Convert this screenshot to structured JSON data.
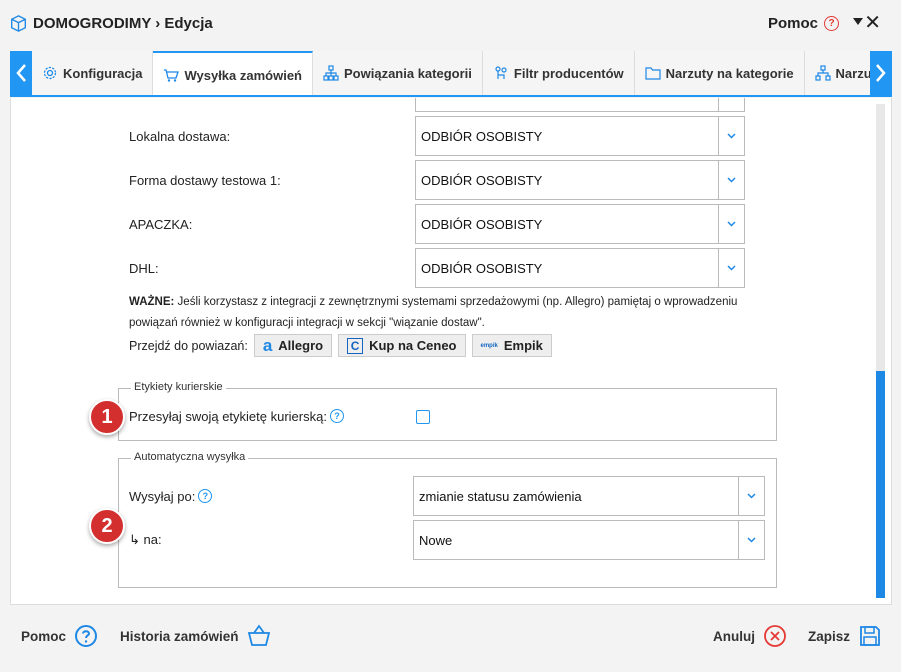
{
  "window": {
    "title": "DOMOGRODIMY › Edycja",
    "help_label": "Pomoc",
    "help_q": "?"
  },
  "tabs": [
    {
      "label": "Konfiguracja",
      "icon": "gear-icon"
    },
    {
      "label": "Wysyłka zamówień",
      "icon": "cart-icon"
    },
    {
      "label": "Powiązania kategorii",
      "icon": "sitemap-icon"
    },
    {
      "label": "Filtr producentów",
      "icon": "filter-icon"
    },
    {
      "label": "Narzuty na kategorie",
      "icon": "folder-icon"
    },
    {
      "label": "Narzu",
      "icon": "sitemap-icon"
    }
  ],
  "shipping_mappings": [
    {
      "label": "Lokalna dostawa:",
      "value": "ODBIÓR OSOBISTY"
    },
    {
      "label": "Forma dostawy testowa 1:",
      "value": "ODBIÓR OSOBISTY"
    },
    {
      "label": "APACZKA:",
      "value": "ODBIÓR OSOBISTY"
    },
    {
      "label": "DHL:",
      "value": "ODBIÓR OSOBISTY"
    }
  ],
  "note": {
    "bold": "WAŻNE:",
    "text": " Jeśli korzystasz z integracji z zewnętrznymi systemami sprzedażowymi (np. Allegro) pamiętaj o wprowadzeniu powiązań również w konfiguracji integracji w sekcji \"wiązanie dostaw\"."
  },
  "goto": {
    "label": "Przejdź do powiazań:",
    "allegro": "Allegro",
    "allegro_icon": "a",
    "ceneo": "Kup na Ceneo",
    "ceneo_icon": "C",
    "empik": "Empik",
    "empik_icon": "empik"
  },
  "labels_section": {
    "legend": "Etykiety kurierskie",
    "send_label": "Przesyłaj swoją etykietę kurierską:",
    "help_q": "?",
    "checked": false
  },
  "auto_section": {
    "legend": "Automatyczna wysyłka",
    "send_after_label": "Wysyłaj po:",
    "help_q": "?",
    "send_after_value": "zmianie statusu zamówienia",
    "to_label": "↳ na:",
    "to_value": "Nowe"
  },
  "badges": {
    "one": "1",
    "two": "2"
  },
  "footer": {
    "help": "Pomoc",
    "history": "Historia zamówień",
    "cancel": "Anuluj",
    "save": "Zapisz"
  },
  "colors": {
    "accent": "#2196f3",
    "badge": "#d32f2f",
    "cancel": "#e53935"
  }
}
